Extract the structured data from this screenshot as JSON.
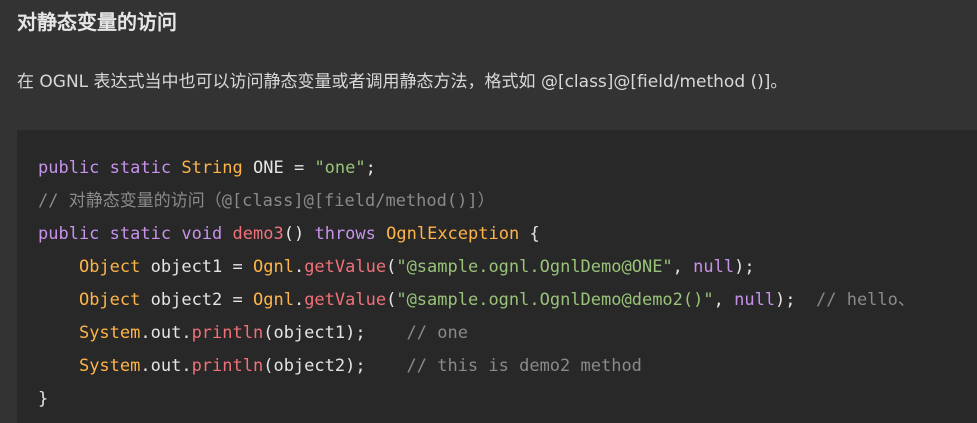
{
  "heading": "对静态变量的访问",
  "paragraph": "在 OGNL 表达式当中也可以访问静态变量或者调用静态方法，格式如 @[class]@[field/method ()]。",
  "code": {
    "l1": {
      "kw_public": "public",
      "kw_static": "static",
      "type_string": "String",
      "rest": "ONE = ",
      "str_one": "\"one\"",
      "semi": ";"
    },
    "l2": {
      "comment": "// 对静态变量的访问（@[class]@[field/method()]）"
    },
    "l3": {
      "kw_public": "public",
      "kw_static": "static",
      "kw_void": "void",
      "fn_demo3": "demo3",
      "parens": "()",
      "kw_throws": "throws",
      "type_exc": "OgnlException",
      "brace": "{"
    },
    "l4": {
      "indent": "    ",
      "type_object": "Object",
      "var": "object1 = ",
      "type_ognl": "Ognl",
      "dot": ".",
      "fn_getvalue": "getValue",
      "open": "(",
      "str_arg": "\"@sample.ognl.OgnlDemo@ONE\"",
      "comma": ", ",
      "kw_null": "null",
      "close": ");"
    },
    "l5": {
      "indent": "    ",
      "type_object": "Object",
      "var": "object2 = ",
      "type_ognl": "Ognl",
      "dot": ".",
      "fn_getvalue": "getValue",
      "open": "(",
      "str_arg": "\"@sample.ognl.OgnlDemo@demo2()\"",
      "comma": ", ",
      "kw_null": "null",
      "close": ");  ",
      "comment": "// hello、"
    },
    "l6": {
      "indent": "    ",
      "type_system": "System",
      "mid": ".out.",
      "fn_println": "println",
      "args": "(object1);    ",
      "comment": "// one"
    },
    "l7": {
      "indent": "    ",
      "type_system": "System",
      "mid": ".out.",
      "fn_println": "println",
      "args": "(object2);    ",
      "comment": "// this is demo2 method"
    },
    "l8": {
      "brace": "}"
    }
  },
  "colors": {
    "page_bg": "#333333",
    "code_bg": "#282828",
    "keyword": "#c792ea",
    "type": "#ffb447",
    "function": "#f07178",
    "string": "#98c379",
    "comment": "#8a8a8a",
    "text": "#e4e4e4"
  }
}
